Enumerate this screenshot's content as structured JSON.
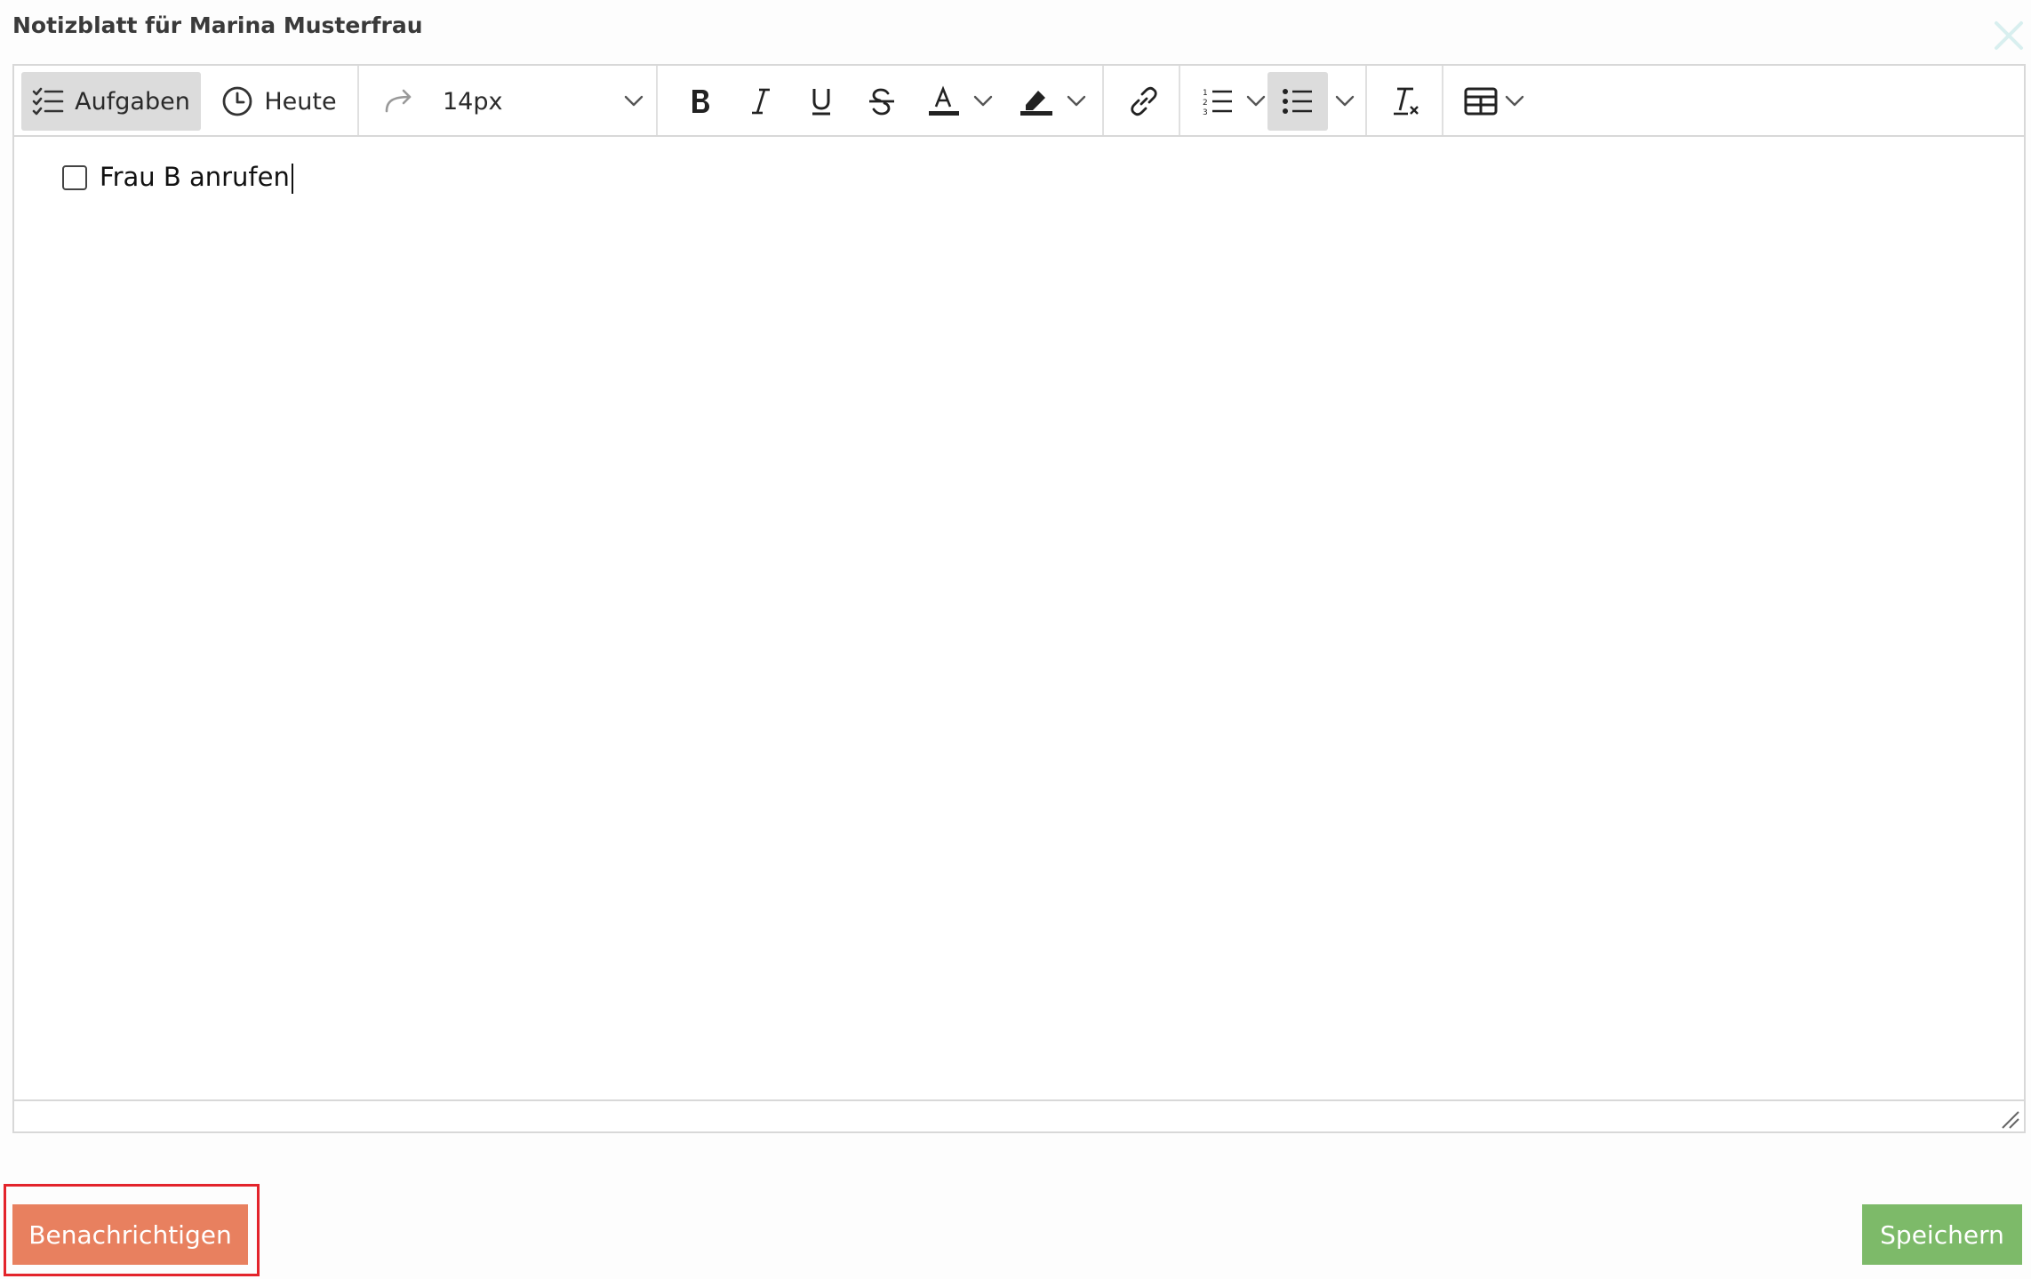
{
  "dialog": {
    "title": "Notizblatt für Marina Musterfrau"
  },
  "toolbar": {
    "tasks_label": "Aufgaben",
    "today_label": "Heute",
    "font_size": "14px"
  },
  "content": {
    "tasks": [
      {
        "text": "Frau B anrufen",
        "checked": false
      }
    ]
  },
  "footer": {
    "notify_label": "Benachrichtigen",
    "save_label": "Speichern"
  },
  "colors": {
    "notify_button": "#e8805f",
    "save_button": "#7dba69",
    "highlight": "#e3242b"
  }
}
